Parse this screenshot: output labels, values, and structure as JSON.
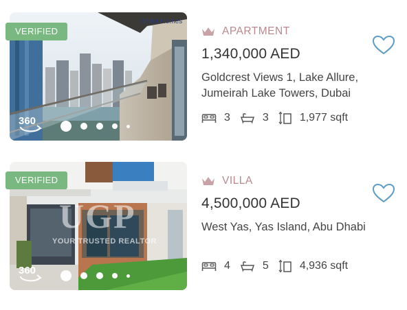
{
  "listings": [
    {
      "verified_label": "VERIFIED",
      "tour_label": "360",
      "photo_text": "Better Homes",
      "type": "APARTMENT",
      "price": "1,340,000 AED",
      "address": "Goldcrest Views 1, Lake Allure, Jumeirah Lake Towers, Dubai",
      "beds": "3",
      "baths": "3",
      "area": "1,977 sqft",
      "carousel_current": 1,
      "carousel_visible_dots": 5
    },
    {
      "verified_label": "VERIFIED",
      "tour_label": "360",
      "watermark": "UGP",
      "watermark_tagline": "YOUR TRUSTED REALTOR",
      "type": "VILLA",
      "price": "4,500,000 AED",
      "address": "West Yas, Yas Island, Abu Dhabi",
      "beds": "4",
      "baths": "5",
      "area": "4,936 sqft",
      "carousel_current": 1,
      "carousel_visible_dots": 5
    }
  ],
  "colors": {
    "verified_badge": "#7ab882",
    "type_label": "#b9888f",
    "favorite_heart": "#5b9bc4"
  },
  "icons": [
    "crown-icon",
    "heart-icon",
    "bed-icon",
    "bath-icon",
    "area-icon",
    "tour-360-icon"
  ]
}
